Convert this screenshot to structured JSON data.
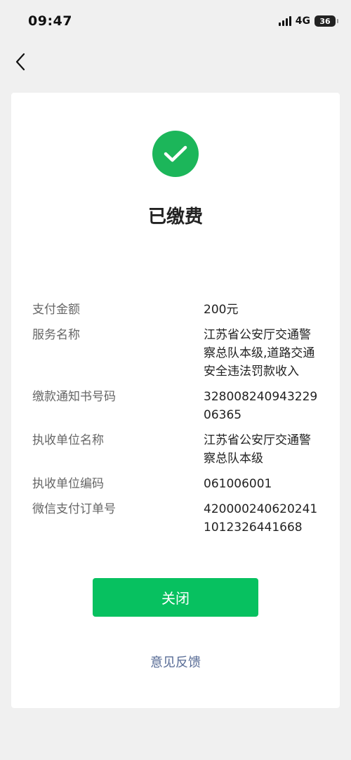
{
  "status_bar": {
    "time": "09:47",
    "network": "4G",
    "battery": "36"
  },
  "nav": {
    "back_icon": "chevron-left-icon"
  },
  "result": {
    "icon": "check-icon",
    "icon_color": "#1cb65a",
    "title": "已缴费"
  },
  "details": [
    {
      "label": "支付金额",
      "value": "200元"
    },
    {
      "label": "服务名称",
      "value": "江苏省公安厅交通警察总队本级,道路交通安全违法罚款收入"
    },
    {
      "label": "缴款通知书号码",
      "value": "32800824094322906365"
    },
    {
      "label": "执收单位名称",
      "value": "江苏省公安厅交通警察总队本级"
    },
    {
      "label": "执收单位编码",
      "value": "061006001"
    },
    {
      "label": "微信支付订单号",
      "value": "4200002406202411012326441668"
    }
  ],
  "actions": {
    "close_label": "关闭",
    "close_color": "#07c160",
    "feedback_label": "意见反馈",
    "feedback_color": "#576b95"
  }
}
